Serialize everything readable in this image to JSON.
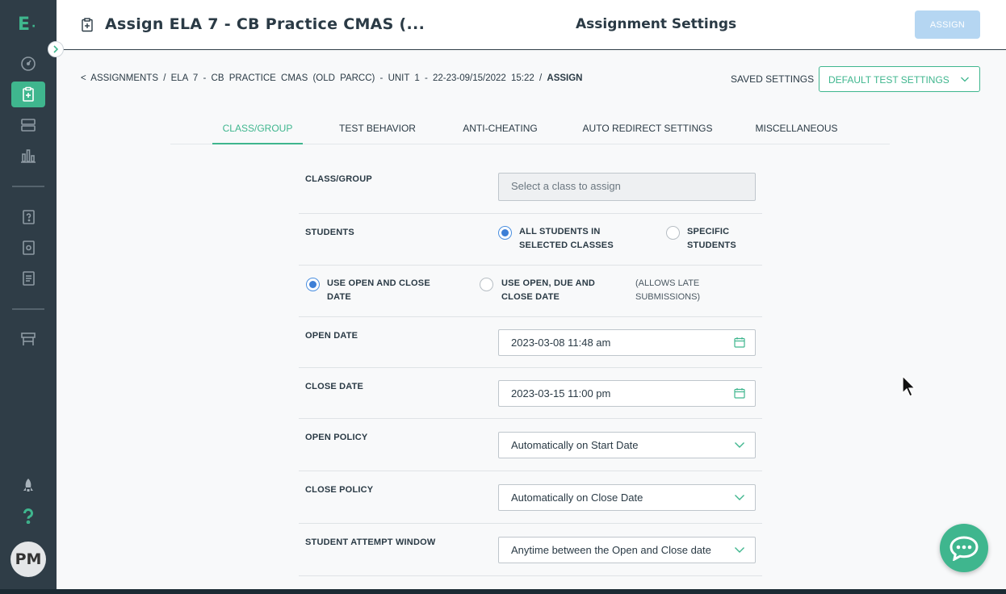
{
  "sidebar": {
    "logo": "E",
    "avatar": "PM",
    "icons": [
      "dashboard-icon",
      "assignments-icon",
      "playlist-icon",
      "reports-icon",
      "item-bank-icon",
      "test-library-icon",
      "playlist-library-icon",
      "classroom-icon",
      "rocket-icon",
      "help-icon"
    ]
  },
  "header": {
    "title": "Assign ELA 7 - CB Practice CMAS (...",
    "center_title": "Assignment Settings",
    "assign_button": "ASSIGN"
  },
  "breadcrumb": {
    "back": "<",
    "items": [
      "ASSIGNMENTS",
      "ELA 7 - CB PRACTICE CMAS (OLD PARCC) - UNIT 1 - 22-23-09/15/2022 15:22"
    ],
    "current": "ASSIGN",
    "separator": "/"
  },
  "saved_settings": {
    "label": "SAVED SETTINGS",
    "value": "DEFAULT TEST SETTINGS"
  },
  "tabs": [
    {
      "label": "CLASS/GROUP",
      "active": true
    },
    {
      "label": "TEST BEHAVIOR",
      "active": false
    },
    {
      "label": "ANTI-CHEATING",
      "active": false
    },
    {
      "label": "AUTO REDIRECT SETTINGS",
      "active": false
    },
    {
      "label": "MISCELLANEOUS",
      "active": false
    }
  ],
  "form": {
    "class_group": {
      "label": "CLASS/GROUP",
      "placeholder": "Select a class to assign"
    },
    "students": {
      "label": "STUDENTS",
      "option_all": "ALL STUDENTS IN SELECTED CLASSES",
      "option_specific": "SPECIFIC STUDENTS",
      "selected": "all"
    },
    "date_mode": {
      "option_open_close": "USE OPEN AND CLOSE DATE",
      "option_open_due_close": "USE OPEN, DUE AND CLOSE DATE",
      "note": "(ALLOWS LATE SUBMISSIONS)",
      "selected": "open_close"
    },
    "open_date": {
      "label": "OPEN DATE",
      "value": "2023-03-08 11:48 am"
    },
    "close_date": {
      "label": "CLOSE DATE",
      "value": "2023-03-15 11:00 pm"
    },
    "open_policy": {
      "label": "OPEN POLICY",
      "value": "Automatically on Start Date"
    },
    "close_policy": {
      "label": "CLOSE POLICY",
      "value": "Automatically on Close Date"
    },
    "attempt_window": {
      "label": "STUDENT ATTEMPT WINDOW",
      "value": "Anytime between the Open and Close date"
    }
  },
  "colors": {
    "accent": "#3fb68e",
    "sidebar": "#2f3d47",
    "assign_disabled": "#b5d6f2",
    "radio_selected": "#3d7fd6"
  }
}
